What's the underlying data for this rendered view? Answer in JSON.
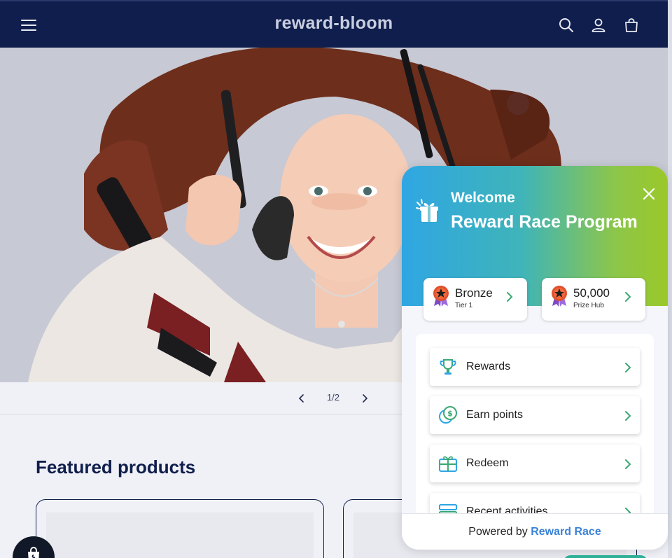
{
  "header": {
    "brand": "reward-bloom",
    "background": "#0f1e4c",
    "icons": [
      "menu-icon",
      "search-icon",
      "account-icon",
      "cart-icon"
    ]
  },
  "hero": {
    "image": "woman-with-makeup-brushes"
  },
  "slider": {
    "counter": "1/2",
    "prev_icon": "chevron-left-icon",
    "next_icon": "chevron-right-icon"
  },
  "featured": {
    "title": "Featured products"
  },
  "widget": {
    "welcome": "Welcome",
    "title": "Reward Race Program",
    "gradient": [
      "#2fa6e3",
      "#9bc829"
    ],
    "tier": {
      "value": "Bronze",
      "label": "Tier 1"
    },
    "prize": {
      "value": "50,000",
      "label": "Prize Hub"
    },
    "menu": [
      {
        "label": "Rewards",
        "icon": "trophy-icon"
      },
      {
        "label": "Earn points",
        "icon": "coins-icon"
      },
      {
        "label": "Redeem",
        "icon": "gift-box-icon"
      },
      {
        "label": "Recent activities",
        "icon": "list-icon"
      }
    ],
    "footer": {
      "prefix": "Powered by",
      "brand": "Reward Race",
      "brand_color": "#3b82d6"
    }
  }
}
